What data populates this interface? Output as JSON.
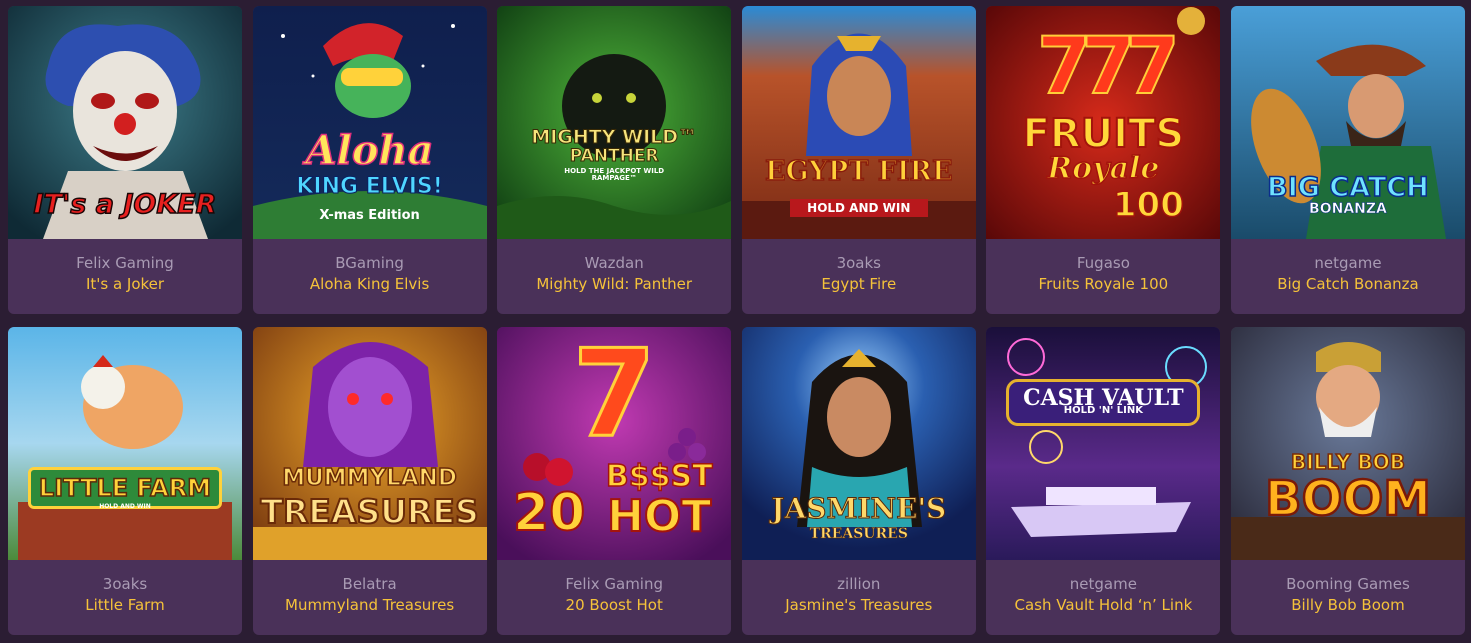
{
  "games": [
    {
      "provider": "Felix Gaming",
      "name": "It's a Joker",
      "logo": [
        "IT's a JOKER"
      ],
      "art": "joker"
    },
    {
      "provider": "BGaming",
      "name": "Aloha King Elvis",
      "logo": [
        "Aloha",
        "KING ELVIS!",
        "X-mas Edition"
      ],
      "art": "elvis"
    },
    {
      "provider": "Wazdan",
      "name": "Mighty Wild: Panther",
      "logo": [
        "MIGHTY WILD™",
        "PANTHER",
        "HOLD THE JACKPOT WILD RAMPAGE™"
      ],
      "art": "panther"
    },
    {
      "provider": "3oaks",
      "name": "Egypt Fire",
      "logo": [
        "EGYPT FIRE",
        "HOLD AND WIN"
      ],
      "art": "egypt"
    },
    {
      "provider": "Fugaso",
      "name": "Fruits Royale 100",
      "logo": [
        "777",
        "FRUITS",
        "Royale",
        "100"
      ],
      "art": "fruits"
    },
    {
      "provider": "netgame",
      "name": "Big Catch Bonanza",
      "logo": [
        "BIG CATCH",
        "BONANZA"
      ],
      "art": "catch"
    },
    {
      "provider": "3oaks",
      "name": "Little Farm",
      "logo": [
        "LITTLE FARM",
        "HOLD AND WIN"
      ],
      "art": "farm"
    },
    {
      "provider": "Belatra",
      "name": "Mummyland Treasures",
      "logo": [
        "MUMMYLAND",
        "TREASURES"
      ],
      "art": "mummy"
    },
    {
      "provider": "Felix Gaming",
      "name": "20 Boost Hot",
      "logo": [
        "7",
        "B$$ST",
        "20",
        "HOT"
      ],
      "art": "boost"
    },
    {
      "provider": "zillion",
      "name": "Jasmine's Treasures",
      "logo": [
        "JASMINE'S",
        "TREASURES"
      ],
      "art": "jasmine"
    },
    {
      "provider": "netgame",
      "name": "Cash Vault Hold ‘n’ Link",
      "logo": [
        "CASH VAULT",
        "HOLD 'N' LINK"
      ],
      "art": "vault"
    },
    {
      "provider": "Booming Games",
      "name": "Billy Bob Boom",
      "logo": [
        "BILLY BOB",
        "BOOM"
      ],
      "art": "billy"
    }
  ],
  "colors": {
    "page_bg": "#2b1d33",
    "card_bg": "#4a3159",
    "provider_text": "#a99bb4",
    "name_text": "#f5c23a"
  }
}
